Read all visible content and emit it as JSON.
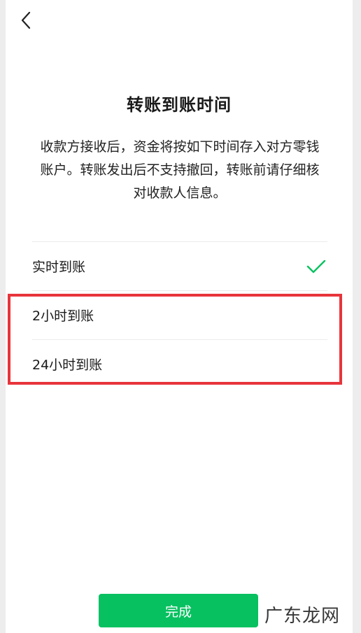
{
  "header": {
    "back_icon": "chevron-left-icon"
  },
  "title": "转账到账时间",
  "description": "收款方接收后，资金将按如下时间存入对方零钱账户。转账发出后不支持撤回，转账前请仔细核对收款人信息。",
  "options": [
    {
      "label": "实时到账",
      "selected": true
    },
    {
      "label": "2小时到账",
      "selected": false
    },
    {
      "label": "24小时到账",
      "selected": false
    }
  ],
  "done_button": "完成",
  "colors": {
    "accent": "#07c160",
    "highlight": "#e8343b"
  },
  "watermark": "广东龙网"
}
